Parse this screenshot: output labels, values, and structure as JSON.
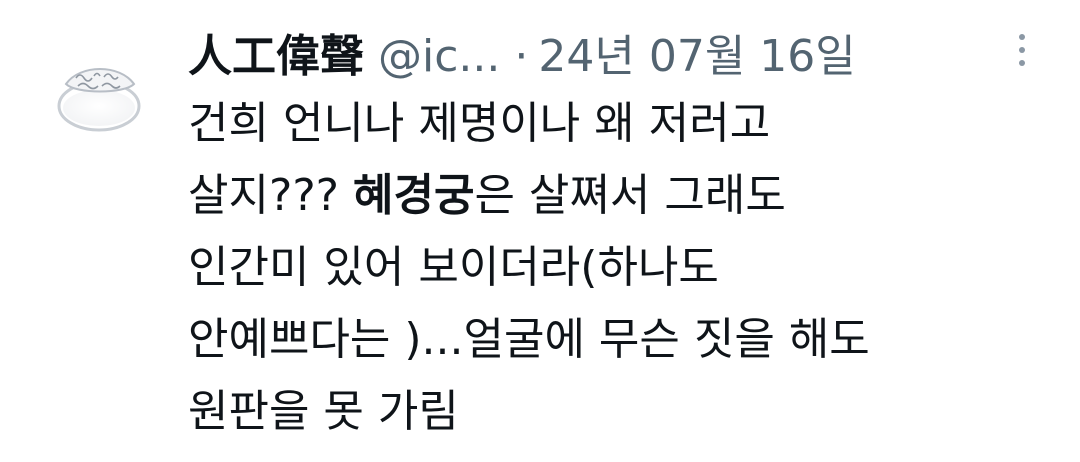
{
  "tweet": {
    "author": {
      "display_name": "人工偉聲",
      "handle": "@ic...",
      "avatar_icon": "ring-avatar-icon"
    },
    "separator": "·",
    "timestamp": "24년 07월 16일",
    "more_icon": "more-vertical-icon",
    "text": {
      "line1": "건희 언니나  제명이나 왜 저러고",
      "line2_pre": "살지??? ",
      "line2_bold": "혜경궁",
      "line2_post": "은 살쪄서 그래도",
      "line3": "인간미 있어 보이더라(하나도",
      "line4": "안예쁘다는 )...얼굴에 무슨 짓을 해도",
      "line5": "원판을 못 가림"
    }
  }
}
